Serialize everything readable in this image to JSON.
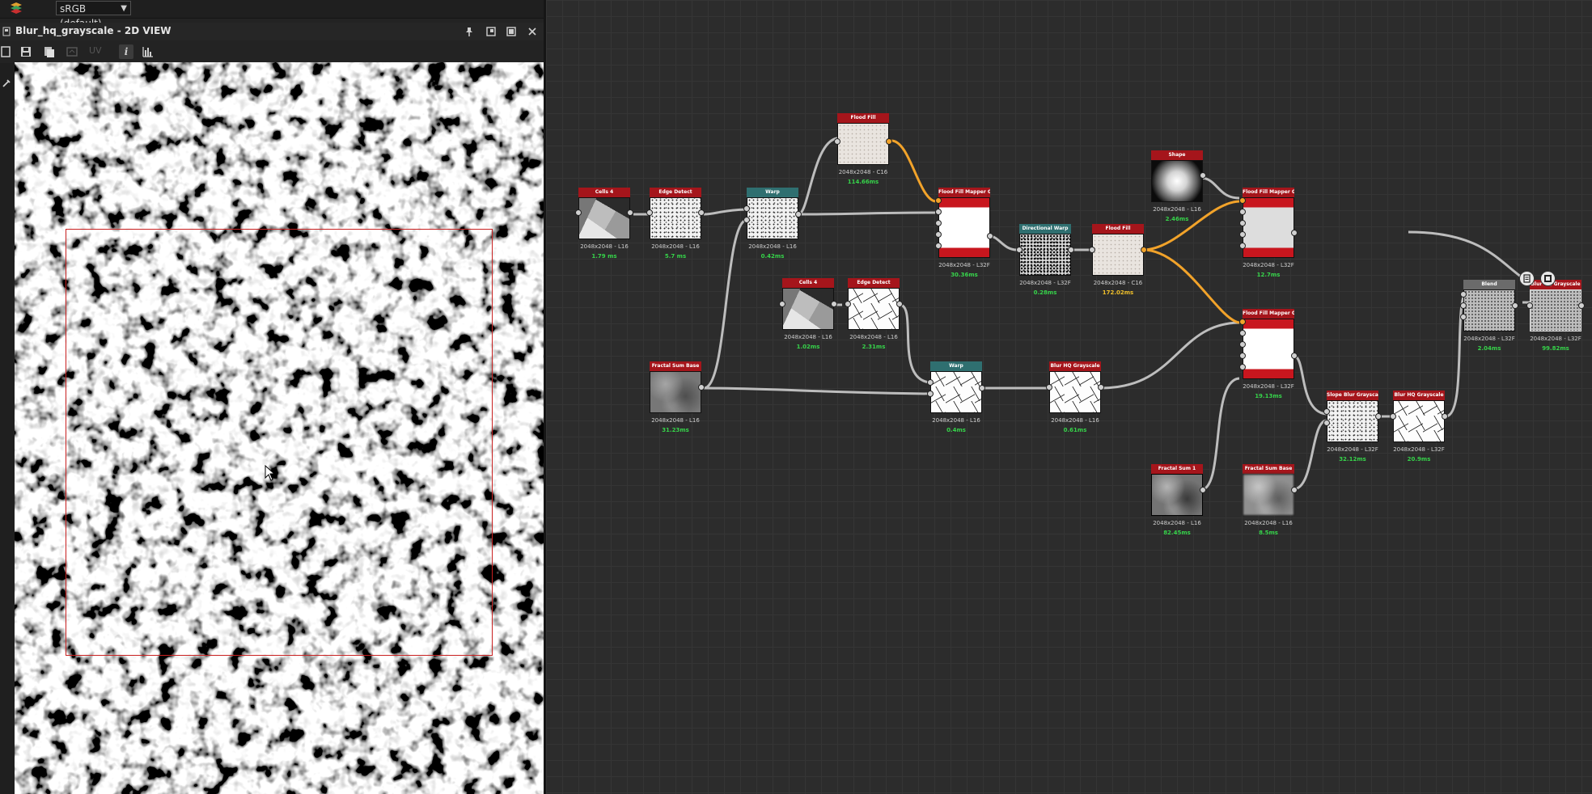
{
  "toolbar_top": {
    "colorspace": "sRGB (default)"
  },
  "panel": {
    "title": "Blur_hq_grayscale - 2D VIEW",
    "uv_label": "UV"
  },
  "nodes": [
    {
      "id": "cells4a",
      "title": "Cells 4",
      "info": "2048x2048 - L16",
      "time": "1.79 ms"
    },
    {
      "id": "edge1",
      "title": "Edge Detect",
      "info": "2048x2048 - L16",
      "time": "5.7 ms"
    },
    {
      "id": "warp1",
      "title": "Warp",
      "info": "2048x2048 - L16",
      "time": "0.42ms"
    },
    {
      "id": "floodfill1",
      "title": "Flood Fill",
      "info": "2048x2048 - C16",
      "time": "114.66ms"
    },
    {
      "id": "ffmap1",
      "title": "Flood Fill Mapper Grays...",
      "info": "2048x2048 - L32F",
      "time": "30.36ms"
    },
    {
      "id": "dirwarp",
      "title": "Directional Warp",
      "info": "2048x2048 - L32F",
      "time": "0.28ms"
    },
    {
      "id": "floodfill2",
      "title": "Flood Fill",
      "info": "2048x2048 - C16",
      "time": "172.02ms"
    },
    {
      "id": "shape",
      "title": "Shape",
      "info": "2048x2048 - L16",
      "time": "2.46ms"
    },
    {
      "id": "ffmap2",
      "title": "Flood Fill Mapper Grays...",
      "info": "2048x2048 - L32F",
      "time": "12.7ms"
    },
    {
      "id": "cells4b",
      "title": "Cells 4",
      "info": "2048x2048 - L16",
      "time": "1.02ms"
    },
    {
      "id": "edge2",
      "title": "Edge Detect",
      "info": "2048x2048 - L16",
      "time": "2.31ms"
    },
    {
      "id": "fractal1",
      "title": "Fractal Sum Base",
      "info": "2048x2048 - L16",
      "time": "31.23ms"
    },
    {
      "id": "warp2",
      "title": "Warp",
      "info": "2048x2048 - L16",
      "time": "0.4ms"
    },
    {
      "id": "blurhq1",
      "title": "Blur HQ Grayscale",
      "info": "2048x2048 - L16",
      "time": "0.61ms"
    },
    {
      "id": "ffmap3",
      "title": "Flood Fill Mapper Grays...",
      "info": "2048x2048 - L32F",
      "time": "19.13ms"
    },
    {
      "id": "slopeblur",
      "title": "Slope Blur Grayscale",
      "info": "2048x2048 - L32F",
      "time": "32.12ms"
    },
    {
      "id": "blurhq2",
      "title": "Blur HQ Grayscale",
      "info": "2048x2048 - L32F",
      "time": "20.9ms"
    },
    {
      "id": "fractal2",
      "title": "Fractal Sum 1",
      "info": "2048x2048 - L16",
      "time": "82.45ms"
    },
    {
      "id": "fractal3",
      "title": "Fractal Sum Base",
      "info": "2048x2048 - L16",
      "time": "8.5ms"
    },
    {
      "id": "blend",
      "title": "Blend",
      "info": "2048x2048 - L32F",
      "time": "2.04ms"
    },
    {
      "id": "blurgs",
      "title": "Blur HQ Grayscale",
      "info": "2048x2048 - L32F",
      "time": "99.82ms"
    }
  ]
}
